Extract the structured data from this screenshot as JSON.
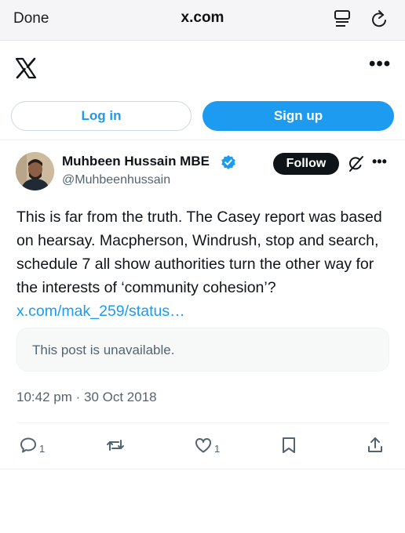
{
  "browser": {
    "done_label": "Done",
    "url": "x.com"
  },
  "header": {
    "login_label": "Log in",
    "signup_label": "Sign up"
  },
  "post": {
    "author_name": "Muhbeen Hussain MBE",
    "author_handle": "@Muhbeenhussain",
    "follow_label": "Follow",
    "text": "This is far from the truth. The Casey report was based on hearsay. Macpherson, Windrush, stop and search, schedule 7 all show authorities turn the other way for the interests of ‘community cohesion’? ",
    "link_text": "x.com/mak_259/status…",
    "quote_text": "This post is unavailable.",
    "timestamp": "10:42 pm · 30 Oct 2018",
    "reply_count": "1",
    "like_count": "1"
  },
  "colors": {
    "accent": "#1d9bf0",
    "text": "#0f1419",
    "secondary": "#536471"
  },
  "icons": [
    "x-logo-icon",
    "reader-mode-icon",
    "reload-icon",
    "more-icon",
    "verified-badge-icon",
    "grok-icon",
    "reply-icon",
    "repost-icon",
    "like-icon",
    "bookmark-icon",
    "share-icon"
  ]
}
